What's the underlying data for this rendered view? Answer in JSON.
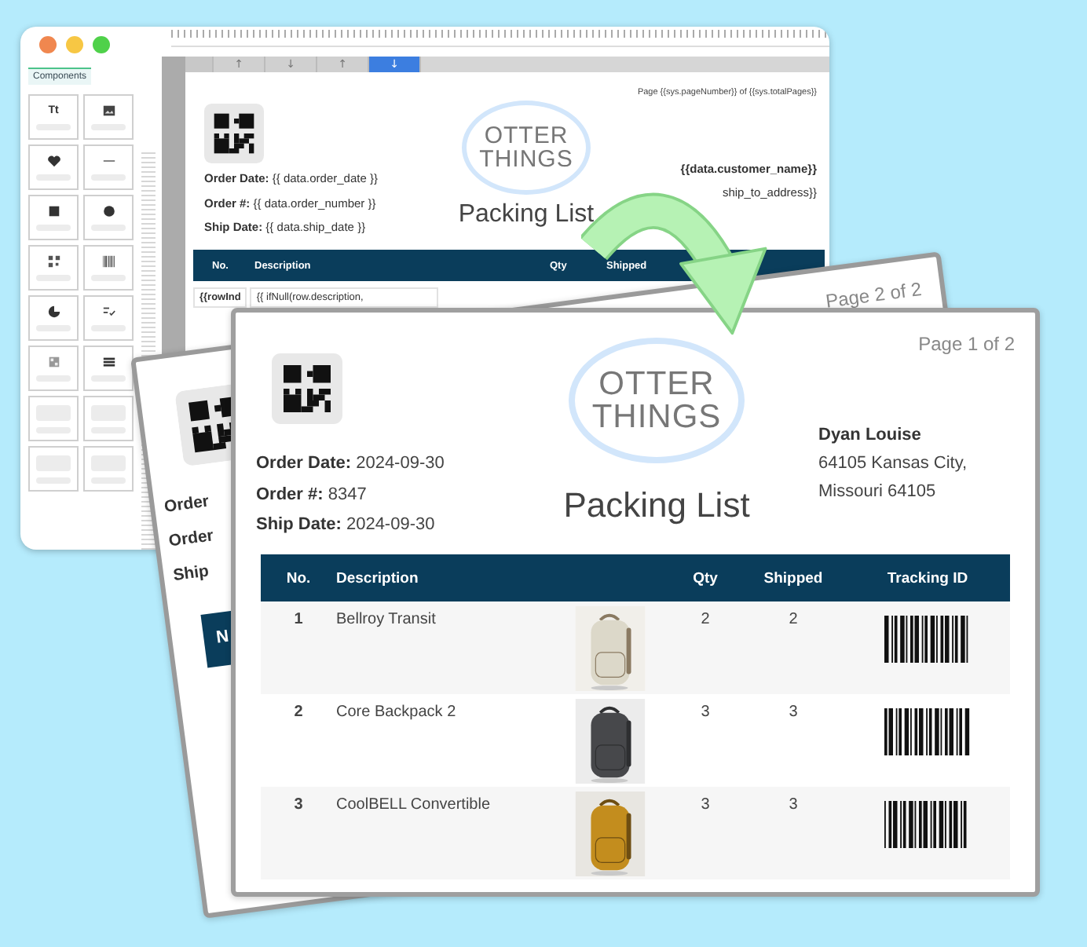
{
  "editor": {
    "palette_title": "Components",
    "text_tool": "Tt",
    "toolbar": [
      {
        "glyph": "↑",
        "selected": false
      },
      {
        "glyph": "↓",
        "selected": false
      },
      {
        "glyph": "↑",
        "selected": false
      },
      {
        "glyph": "↓",
        "selected": true
      }
    ],
    "template": {
      "page_label": "Page {{sys.pageNumber}} of {{sys.totalPages}}",
      "fields": [
        {
          "label": "Order Date:",
          "value": "{{ data.order_date }}"
        },
        {
          "label": "Order #:",
          "value": "{{ data.order_number }}"
        },
        {
          "label": "Ship Date:",
          "value": "{{ data.ship_date }}"
        }
      ],
      "logo": [
        "OTTER",
        "THINGS"
      ],
      "title": "Packing List",
      "customer": "{{data.customer_name}}",
      "address": "ship_to_address}}",
      "columns": [
        "No.",
        "Description",
        "Qty",
        "Shipped"
      ],
      "row": [
        "{{rowInd",
        "{{ ifNull(row.description,"
      ]
    }
  },
  "back_page": {
    "page_label": "Page 2 of 2",
    "labels": [
      "Order",
      "Order",
      "Ship"
    ],
    "column": "N"
  },
  "page": {
    "page_label": "Page 1 of 2",
    "fields": [
      {
        "label": "Order Date:",
        "value": "2024-09-30"
      },
      {
        "label": "Order #:",
        "value": "8347"
      },
      {
        "label": "Ship Date:",
        "value": "2024-09-30"
      }
    ],
    "logo": [
      "OTTER",
      "THINGS"
    ],
    "title": "Packing List",
    "customer": "Dyan Louise",
    "address": [
      "64105 Kansas City,",
      "Missouri 64105"
    ],
    "columns": [
      "No.",
      "Description",
      "Qty",
      "Shipped",
      "Tracking ID"
    ],
    "rows": [
      {
        "no": "1",
        "description": "Bellroy Transit",
        "qty": "2",
        "shipped": "2"
      },
      {
        "no": "2",
        "description": "Core Backpack 2",
        "qty": "3",
        "shipped": "3"
      },
      {
        "no": "3",
        "description": "CoolBELL Convertible",
        "qty": "3",
        "shipped": "3"
      }
    ]
  }
}
